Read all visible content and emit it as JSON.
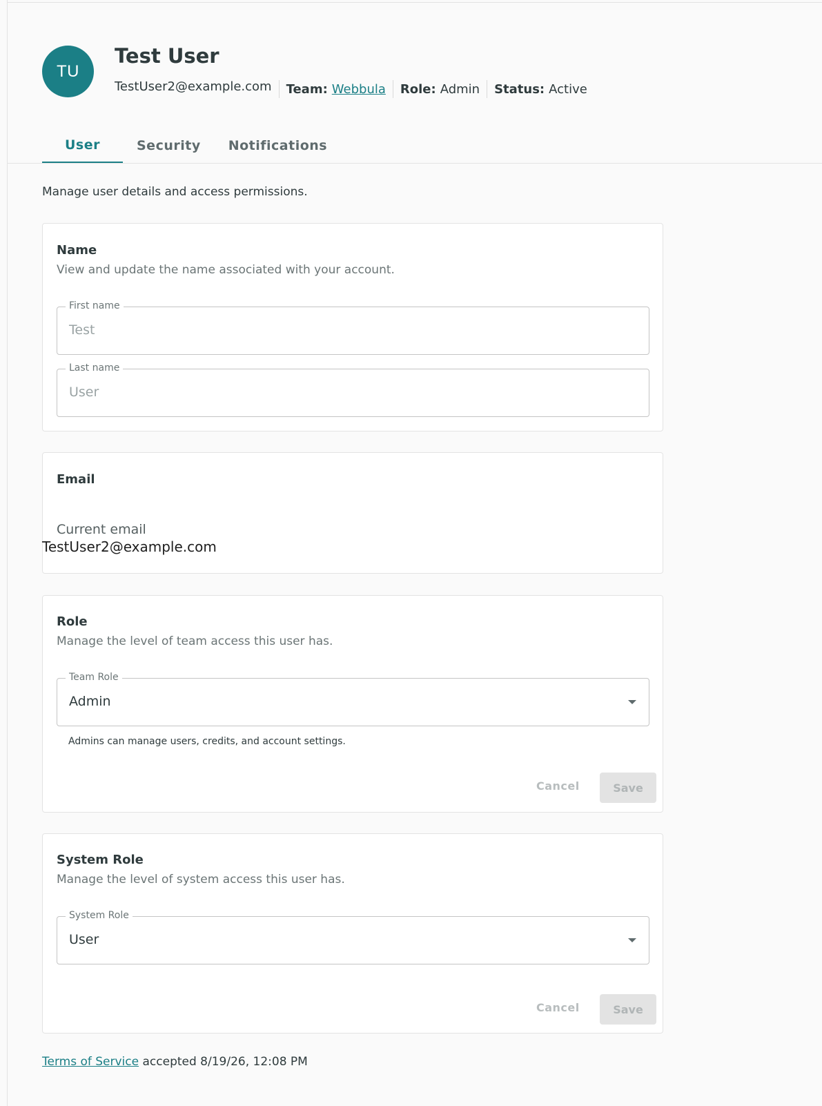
{
  "header": {
    "avatar_initials": "TU",
    "user_name": "Test User",
    "email": "TestUser2@example.com",
    "team_label": "Team:",
    "team_value": "Webbula",
    "role_label": "Role:",
    "role_value": "Admin",
    "status_label": "Status:",
    "status_value": "Active"
  },
  "tabs": [
    {
      "label": "User",
      "active": true
    },
    {
      "label": "Security",
      "active": false
    },
    {
      "label": "Notifications",
      "active": false
    }
  ],
  "intro": "Manage user details and access permissions.",
  "name_card": {
    "title": "Name",
    "description": "View and update the name associated with your account.",
    "first_name_label": "First name",
    "first_name_value": "Test",
    "last_name_label": "Last name",
    "last_name_value": "User"
  },
  "email_card": {
    "title": "Email",
    "current_label": "Current email",
    "current_value": "TestUser2@example.com"
  },
  "role_card": {
    "title": "Role",
    "description": "Manage the level of team access this user has.",
    "select_label": "Team Role",
    "select_value": "Admin",
    "helper": "Admins can manage users, credits, and account settings.",
    "cancel_label": "Cancel",
    "save_label": "Save"
  },
  "system_role_card": {
    "title": "System Role",
    "description": "Manage the level of system access this user has.",
    "select_label": "System Role",
    "select_value": "User",
    "cancel_label": "Cancel",
    "save_label": "Save"
  },
  "footer": {
    "tos_link": "Terms of Service",
    "tos_text": " accepted 8/19/26, 12:08 PM"
  },
  "colors": {
    "accent": "#1b7f86",
    "background": "#fafafa",
    "card": "#ffffff",
    "disabled": "#e3e3e3"
  }
}
